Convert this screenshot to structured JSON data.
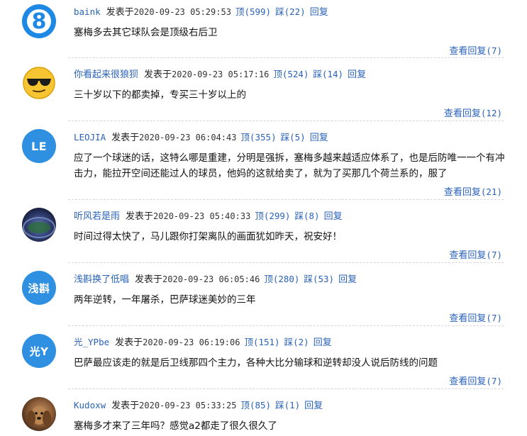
{
  "common": {
    "posted_label": "发表于",
    "up_label": "顶",
    "down_label": "踩",
    "reply_label": "回复",
    "view_replies_label": "查看回复"
  },
  "comments": [
    {
      "user": "baink",
      "avatar_text": "8",
      "time": "2020-09-23 05:29:53",
      "up": "(599)",
      "down": "(22)",
      "text": "塞梅多去其它球队会是顶级右后卫",
      "replies": "(7)"
    },
    {
      "user": "你看起来很狼狈",
      "avatar_text": "😎",
      "time": "2020-09-23 05:17:16",
      "up": "(524)",
      "down": "(14)",
      "text": "三十岁以下的都卖掉，专买三十岁以上的",
      "replies": "(12)"
    },
    {
      "user": "LEOJIA",
      "avatar_text": "LE",
      "time": "2020-09-23 06:04:43",
      "up": "(355)",
      "down": "(5)",
      "text": "应了一个球迷的话，这特么哪是重建，分明是强拆，塞梅多越来越适应体系了，也是后防唯一一个有冲击力，能拉开空间还能过人的球员，他妈的这就给卖了，就为了买那几个荷兰系的，服了",
      "replies": "(21)"
    },
    {
      "user": "听风若是雨",
      "avatar_text": "",
      "time": "2020-09-23 05:40:33",
      "up": "(299)",
      "down": "(8)",
      "text": "时间过得太快了，马儿跟你打架离队的画面犹如昨天，祝安好！",
      "replies": "(7)"
    },
    {
      "user": "浅斟换了低唱",
      "avatar_text": "浅斟",
      "time": "2020-09-23 06:05:46",
      "up": "(280)",
      "down": "(53)",
      "text": "两年逆转，一年屠杀，巴萨球迷美妙的三年",
      "replies": "(7)"
    },
    {
      "user": "光_YPbe",
      "avatar_text": "光Y",
      "time": "2020-09-23 06:19:06",
      "up": "(151)",
      "down": "(2)",
      "text": "巴萨最应该走的就是后卫线那四个主力，各种大比分输球和逆转却没人说后防线的问题",
      "replies": "(7)"
    },
    {
      "user": "Kudoxw",
      "avatar_text": "",
      "time": "2020-09-23 05:33:25",
      "up": "(85)",
      "down": "(1)",
      "text": "塞梅多才来了三年吗？感觉a2都走了很久很久了",
      "replies": ""
    }
  ]
}
